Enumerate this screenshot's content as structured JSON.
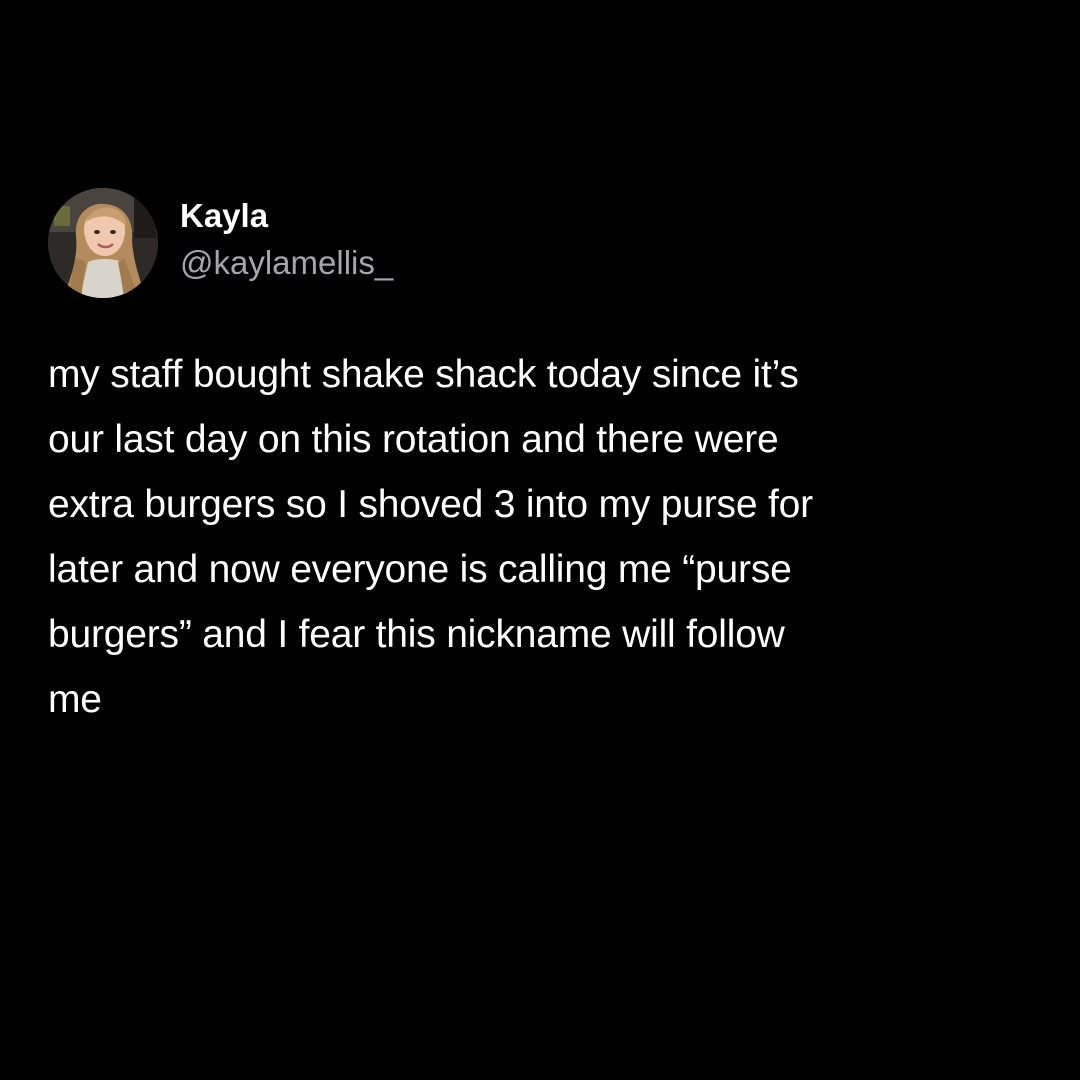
{
  "author": {
    "display_name": "Kayla",
    "handle": "@kaylamellis_",
    "avatar_icon": "profile-photo-avatar"
  },
  "tweet": {
    "text": "my staff bought shake shack today since it’s\nour last day on this rotation and there were\nextra burgers so I shoved 3 into my purse for\nlater and now everyone is calling me “purse\nburgers” and I fear this nickname will follow\nme"
  },
  "colors": {
    "background": "#000000",
    "name": "#ffffff",
    "handle": "#a4a6ab",
    "body": "#ffffff"
  }
}
